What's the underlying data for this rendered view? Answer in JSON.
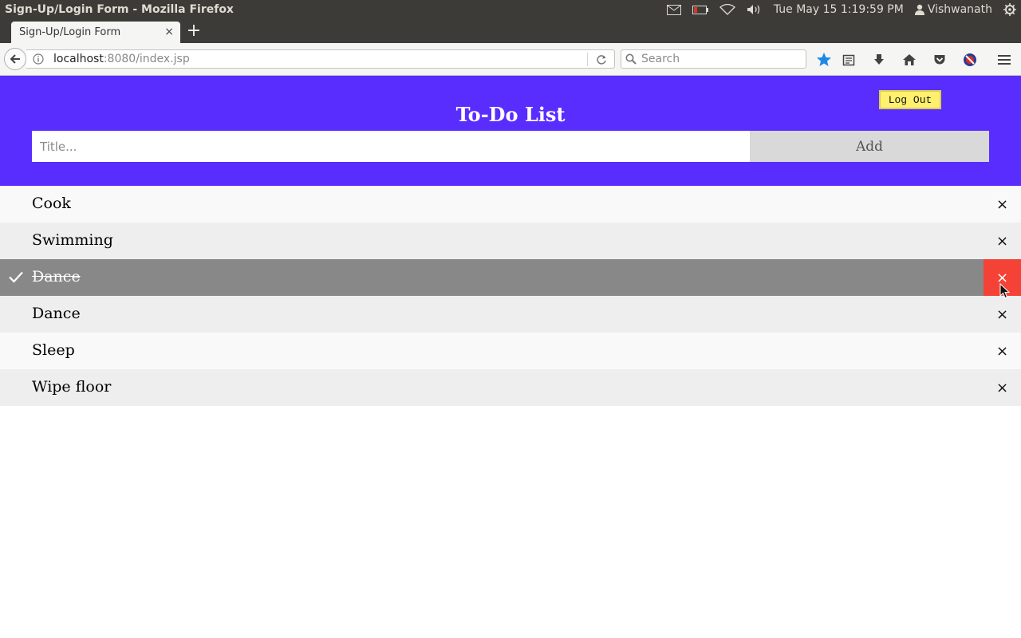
{
  "os_panel": {
    "window_title": "Sign-Up/Login Form - Mozilla Firefox",
    "datetime": "Tue May 15  1:19:59 PM",
    "user": "Vishwanath",
    "indicators": [
      "mail-icon",
      "battery-icon",
      "wifi-icon",
      "volume-icon",
      "user-icon",
      "gear-icon"
    ]
  },
  "browser": {
    "tab_title": "Sign-Up/Login Form",
    "tab_close": "×",
    "new_tab": "+",
    "url_host": "localhost",
    "url_rest": ":8080/index.jsp",
    "search_placeholder": "Search"
  },
  "page": {
    "title": "To-Do List",
    "logout_label": "Log Out",
    "input_placeholder": "Title...",
    "add_label": "Add",
    "colors": {
      "header_bg": "#5a2dff",
      "logout_bg": "#fff06e",
      "checked_bg": "#888888",
      "close_hover_bg": "#f44336"
    },
    "close_glyph": "×",
    "todos": [
      {
        "label": "Cook",
        "checked": false
      },
      {
        "label": "Swimming",
        "checked": false
      },
      {
        "label": "Dance",
        "checked": true
      },
      {
        "label": "Dance",
        "checked": false
      },
      {
        "label": "Sleep",
        "checked": false
      },
      {
        "label": "Wipe floor",
        "checked": false
      }
    ]
  }
}
